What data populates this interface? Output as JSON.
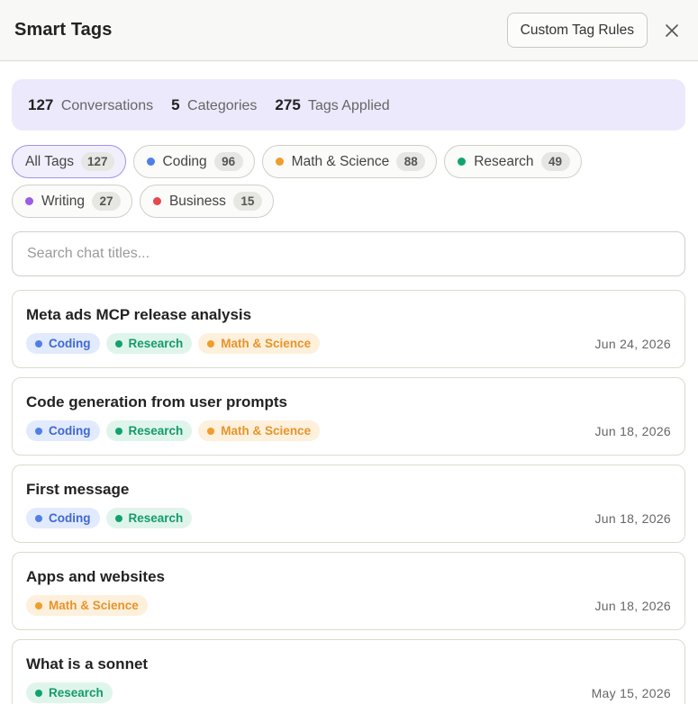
{
  "header": {
    "title": "Smart Tags",
    "rules_button": "Custom Tag Rules"
  },
  "stats": {
    "conversations": {
      "num": "127",
      "label": "Conversations"
    },
    "categories": {
      "num": "5",
      "label": "Categories"
    },
    "tags": {
      "num": "275",
      "label": "Tags Applied"
    }
  },
  "filters": [
    {
      "label": "All Tags",
      "count": "127",
      "color": "",
      "active": true
    },
    {
      "label": "Coding",
      "count": "96",
      "color": "#4f7fe8"
    },
    {
      "label": "Math & Science",
      "count": "88",
      "color": "#ef9d2b"
    },
    {
      "label": "Research",
      "count": "49",
      "color": "#12a272"
    },
    {
      "label": "Writing",
      "count": "27",
      "color": "#9b5de5"
    },
    {
      "label": "Business",
      "count": "15",
      "color": "#e5484d"
    }
  ],
  "search": {
    "placeholder": "Search chat titles...",
    "value": ""
  },
  "conversations": [
    {
      "title": "Meta ads MCP release analysis",
      "date": "Jun 24, 2026",
      "tags": [
        "Coding",
        "Research",
        "Math & Science"
      ]
    },
    {
      "title": "Code generation from user prompts",
      "date": "Jun 18, 2026",
      "tags": [
        "Coding",
        "Research",
        "Math & Science"
      ]
    },
    {
      "title": "First message",
      "date": "Jun 18, 2026",
      "tags": [
        "Coding",
        "Research"
      ]
    },
    {
      "title": "Apps and websites",
      "date": "Jun 18, 2026",
      "tags": [
        "Math & Science"
      ]
    },
    {
      "title": "What is a sonnet",
      "date": "May 15, 2026",
      "tags": [
        "Research"
      ]
    }
  ]
}
